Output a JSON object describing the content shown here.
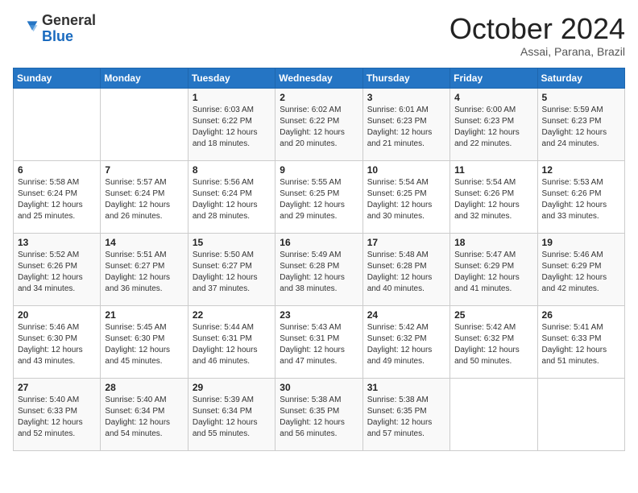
{
  "header": {
    "logo_line1": "General",
    "logo_line2": "Blue",
    "month_title": "October 2024",
    "subtitle": "Assai, Parana, Brazil"
  },
  "weekdays": [
    "Sunday",
    "Monday",
    "Tuesday",
    "Wednesday",
    "Thursday",
    "Friday",
    "Saturday"
  ],
  "weeks": [
    [
      {
        "day": "",
        "info": ""
      },
      {
        "day": "",
        "info": ""
      },
      {
        "day": "1",
        "info": "Sunrise: 6:03 AM\nSunset: 6:22 PM\nDaylight: 12 hours and 18 minutes."
      },
      {
        "day": "2",
        "info": "Sunrise: 6:02 AM\nSunset: 6:22 PM\nDaylight: 12 hours and 20 minutes."
      },
      {
        "day": "3",
        "info": "Sunrise: 6:01 AM\nSunset: 6:23 PM\nDaylight: 12 hours and 21 minutes."
      },
      {
        "day": "4",
        "info": "Sunrise: 6:00 AM\nSunset: 6:23 PM\nDaylight: 12 hours and 22 minutes."
      },
      {
        "day": "5",
        "info": "Sunrise: 5:59 AM\nSunset: 6:23 PM\nDaylight: 12 hours and 24 minutes."
      }
    ],
    [
      {
        "day": "6",
        "info": "Sunrise: 5:58 AM\nSunset: 6:24 PM\nDaylight: 12 hours and 25 minutes."
      },
      {
        "day": "7",
        "info": "Sunrise: 5:57 AM\nSunset: 6:24 PM\nDaylight: 12 hours and 26 minutes."
      },
      {
        "day": "8",
        "info": "Sunrise: 5:56 AM\nSunset: 6:24 PM\nDaylight: 12 hours and 28 minutes."
      },
      {
        "day": "9",
        "info": "Sunrise: 5:55 AM\nSunset: 6:25 PM\nDaylight: 12 hours and 29 minutes."
      },
      {
        "day": "10",
        "info": "Sunrise: 5:54 AM\nSunset: 6:25 PM\nDaylight: 12 hours and 30 minutes."
      },
      {
        "day": "11",
        "info": "Sunrise: 5:54 AM\nSunset: 6:26 PM\nDaylight: 12 hours and 32 minutes."
      },
      {
        "day": "12",
        "info": "Sunrise: 5:53 AM\nSunset: 6:26 PM\nDaylight: 12 hours and 33 minutes."
      }
    ],
    [
      {
        "day": "13",
        "info": "Sunrise: 5:52 AM\nSunset: 6:26 PM\nDaylight: 12 hours and 34 minutes."
      },
      {
        "day": "14",
        "info": "Sunrise: 5:51 AM\nSunset: 6:27 PM\nDaylight: 12 hours and 36 minutes."
      },
      {
        "day": "15",
        "info": "Sunrise: 5:50 AM\nSunset: 6:27 PM\nDaylight: 12 hours and 37 minutes."
      },
      {
        "day": "16",
        "info": "Sunrise: 5:49 AM\nSunset: 6:28 PM\nDaylight: 12 hours and 38 minutes."
      },
      {
        "day": "17",
        "info": "Sunrise: 5:48 AM\nSunset: 6:28 PM\nDaylight: 12 hours and 40 minutes."
      },
      {
        "day": "18",
        "info": "Sunrise: 5:47 AM\nSunset: 6:29 PM\nDaylight: 12 hours and 41 minutes."
      },
      {
        "day": "19",
        "info": "Sunrise: 5:46 AM\nSunset: 6:29 PM\nDaylight: 12 hours and 42 minutes."
      }
    ],
    [
      {
        "day": "20",
        "info": "Sunrise: 5:46 AM\nSunset: 6:30 PM\nDaylight: 12 hours and 43 minutes."
      },
      {
        "day": "21",
        "info": "Sunrise: 5:45 AM\nSunset: 6:30 PM\nDaylight: 12 hours and 45 minutes."
      },
      {
        "day": "22",
        "info": "Sunrise: 5:44 AM\nSunset: 6:31 PM\nDaylight: 12 hours and 46 minutes."
      },
      {
        "day": "23",
        "info": "Sunrise: 5:43 AM\nSunset: 6:31 PM\nDaylight: 12 hours and 47 minutes."
      },
      {
        "day": "24",
        "info": "Sunrise: 5:42 AM\nSunset: 6:32 PM\nDaylight: 12 hours and 49 minutes."
      },
      {
        "day": "25",
        "info": "Sunrise: 5:42 AM\nSunset: 6:32 PM\nDaylight: 12 hours and 50 minutes."
      },
      {
        "day": "26",
        "info": "Sunrise: 5:41 AM\nSunset: 6:33 PM\nDaylight: 12 hours and 51 minutes."
      }
    ],
    [
      {
        "day": "27",
        "info": "Sunrise: 5:40 AM\nSunset: 6:33 PM\nDaylight: 12 hours and 52 minutes."
      },
      {
        "day": "28",
        "info": "Sunrise: 5:40 AM\nSunset: 6:34 PM\nDaylight: 12 hours and 54 minutes."
      },
      {
        "day": "29",
        "info": "Sunrise: 5:39 AM\nSunset: 6:34 PM\nDaylight: 12 hours and 55 minutes."
      },
      {
        "day": "30",
        "info": "Sunrise: 5:38 AM\nSunset: 6:35 PM\nDaylight: 12 hours and 56 minutes."
      },
      {
        "day": "31",
        "info": "Sunrise: 5:38 AM\nSunset: 6:35 PM\nDaylight: 12 hours and 57 minutes."
      },
      {
        "day": "",
        "info": ""
      },
      {
        "day": "",
        "info": ""
      }
    ]
  ]
}
